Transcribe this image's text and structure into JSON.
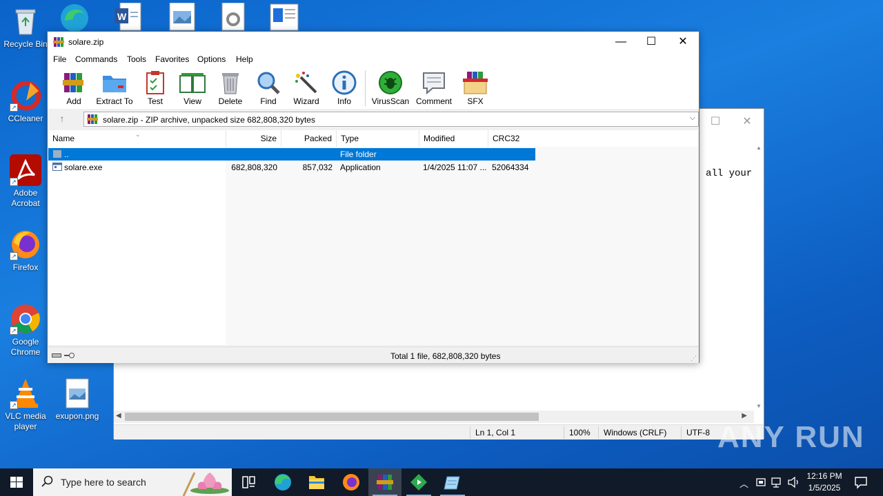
{
  "desktop": {
    "icons": [
      {
        "label": "Recycle Bin"
      },
      {
        "label": "CCleaner"
      },
      {
        "label": "Adobe Acrobat"
      },
      {
        "label": "Firefox"
      },
      {
        "label": "Google Chrome"
      },
      {
        "label": "VLC media player"
      },
      {
        "label": "exupon.png"
      }
    ]
  },
  "notepad": {
    "visible_text": "all your",
    "status": {
      "position": "Ln 1, Col 1",
      "zoom": "100%",
      "line_endings": "Windows (CRLF)",
      "encoding": "UTF-8"
    }
  },
  "winrar": {
    "title": "solare.zip",
    "menu": [
      "File",
      "Commands",
      "Tools",
      "Favorites",
      "Options",
      "Help"
    ],
    "toolbar": [
      "Add",
      "Extract To",
      "Test",
      "View",
      "Delete",
      "Find",
      "Wizard",
      "Info",
      "VirusScan",
      "Comment",
      "SFX"
    ],
    "address": "solare.zip - ZIP archive, unpacked size 682,808,320 bytes",
    "columns": [
      "Name",
      "Size",
      "Packed",
      "Type",
      "Modified",
      "CRC32"
    ],
    "rows": [
      {
        "name": "..",
        "size": "",
        "packed": "",
        "type": "File folder",
        "modified": "",
        "crc": ""
      },
      {
        "name": "solare.exe",
        "size": "682,808,320",
        "packed": "857,032",
        "type": "Application",
        "modified": "1/4/2025 11:07 ...",
        "crc": "52064334"
      }
    ],
    "status": "Total 1 file, 682,808,320 bytes"
  },
  "taskbar": {
    "search_placeholder": "Type here to search",
    "time": "12:16 PM",
    "date": "1/5/2025"
  },
  "watermark": "ANY RUN"
}
